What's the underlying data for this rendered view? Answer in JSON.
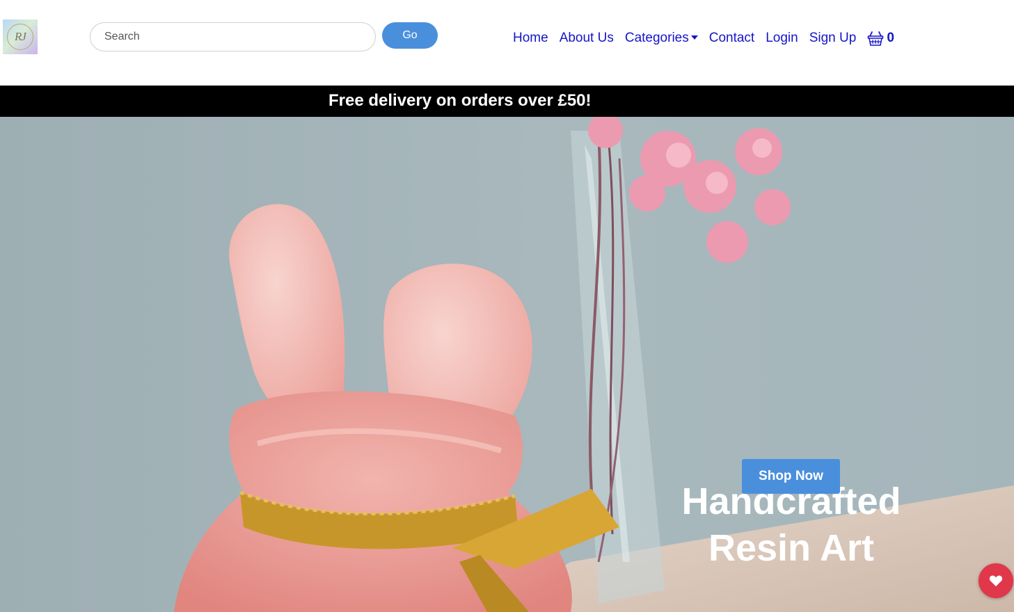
{
  "header": {
    "logo_text": "RJ",
    "search": {
      "placeholder": "Search",
      "value": ""
    },
    "go_label": "Go",
    "nav": {
      "home": "Home",
      "about": "About Us",
      "categories": "Categories",
      "contact": "Contact",
      "login": "Login",
      "signup": "Sign Up"
    },
    "cart": {
      "icon": "basket-icon",
      "count": "0"
    }
  },
  "banner": {
    "text": "Free delivery on orders over £50!"
  },
  "hero": {
    "title_line1": "Handcrafted",
    "title_line2": "Resin Art",
    "cta_label": "Shop Now"
  },
  "floating": {
    "icon": "heart-icon"
  },
  "colors": {
    "brand_blue": "#4a8fdc",
    "nav_link": "#1515c8",
    "banner_bg": "#000000",
    "favorite": "#e0374b"
  }
}
